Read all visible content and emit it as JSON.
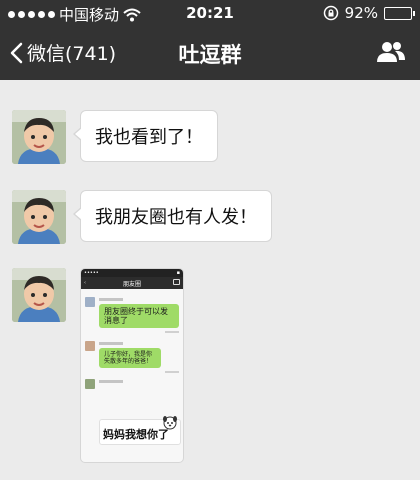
{
  "status_bar": {
    "carrier": "中国移动",
    "time": "20:21",
    "battery": "92%",
    "battery_level": 0.92
  },
  "nav": {
    "back_label": "微信(741)",
    "title": "吐逗群"
  },
  "messages": [
    {
      "text": "我也看到了！"
    },
    {
      "text": "我朋友圈也有人发！"
    }
  ],
  "image_message": {
    "screen_title": "朋友圈",
    "post1_text": "朋友圈终于可以发消息了",
    "post2_text": "儿子你好，我是你失散多年的爸爸！",
    "sticker_text": "妈妈我想你了"
  },
  "colors": {
    "bar": "#333333",
    "chat_background": "#ebebeb",
    "bubble": "#ffffff",
    "green_bubble": "#9fdb67"
  },
  "icons": [
    "back-chevron-icon",
    "wifi-icon",
    "lock-rotation-icon",
    "group-profile-icon"
  ]
}
